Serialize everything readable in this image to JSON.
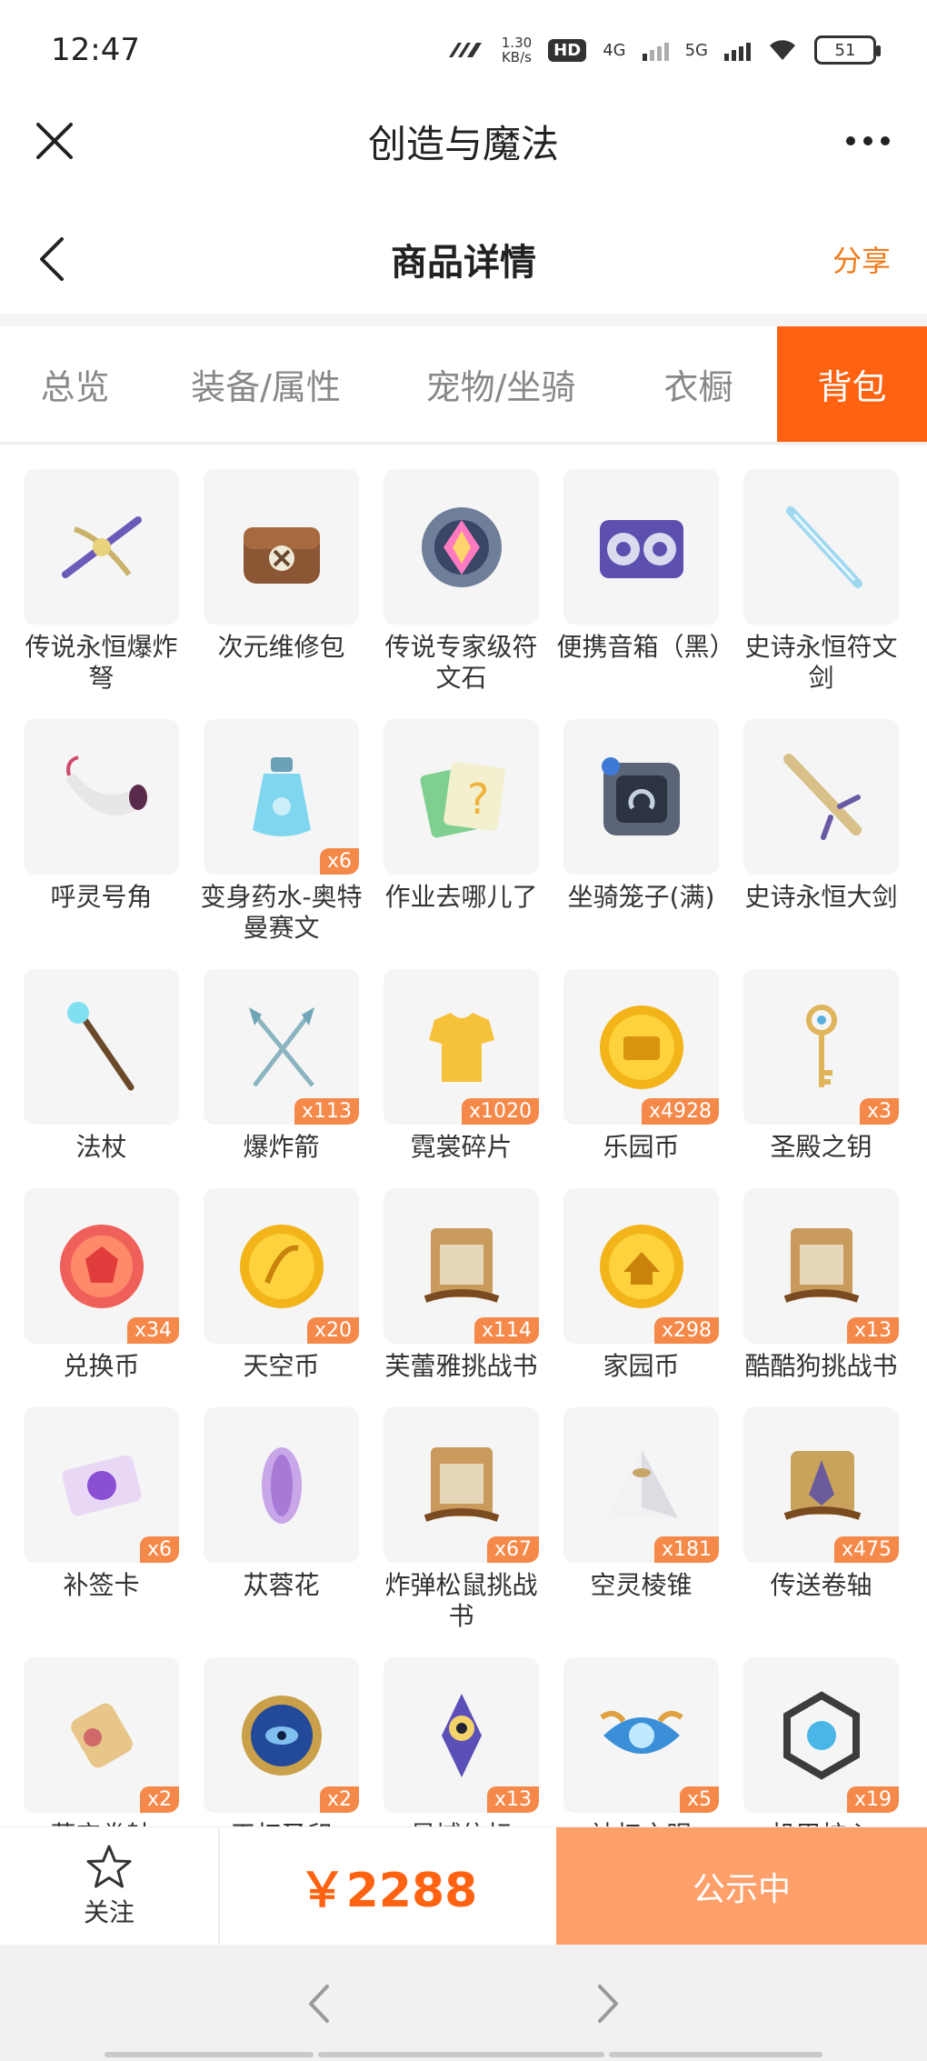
{
  "status_bar": {
    "time": "12:47",
    "net_speed_value": "1.30",
    "net_speed_unit": "KB/s",
    "hd_label": "HD",
    "sim1_label": "4G",
    "sim2_label": "5G",
    "battery": "51"
  },
  "app_bar": {
    "title": "创造与魔法"
  },
  "header": {
    "title": "商品详情",
    "share_label": "分享"
  },
  "tabs": [
    {
      "label": "总览",
      "active": false
    },
    {
      "label": "装备/属性",
      "active": false
    },
    {
      "label": "宠物/坐骑",
      "active": false
    },
    {
      "label": "衣橱",
      "active": false
    },
    {
      "label": "背包",
      "active": true
    }
  ],
  "items": [
    {
      "name": "传说永恒爆炸弩",
      "qty": "",
      "icon": "crossbow-icon"
    },
    {
      "name": "次元维修包",
      "qty": "",
      "icon": "repair-bag-icon"
    },
    {
      "name": "传说专家级符文石",
      "qty": "",
      "icon": "rune-stone-icon"
    },
    {
      "name": "便携音箱（黑）",
      "qty": "",
      "icon": "speaker-icon"
    },
    {
      "name": "史诗永恒符文剑",
      "qty": "",
      "icon": "rune-sword-icon"
    },
    {
      "name": "呼灵号角",
      "qty": "",
      "icon": "horn-icon"
    },
    {
      "name": "变身药水-奥特曼赛文",
      "qty": "x6",
      "icon": "potion-icon"
    },
    {
      "name": "作业去哪儿了",
      "qty": "",
      "icon": "homework-icon"
    },
    {
      "name": "坐骑笼子(满)",
      "qty": "",
      "icon": "mount-cage-icon"
    },
    {
      "name": "史诗永恒大剑",
      "qty": "",
      "icon": "greatsword-icon"
    },
    {
      "name": "法杖",
      "qty": "",
      "icon": "staff-icon"
    },
    {
      "name": "爆炸箭",
      "qty": "x113",
      "icon": "arrow-icon"
    },
    {
      "name": "霓裳碎片",
      "qty": "x1020",
      "icon": "shirt-fragment-icon"
    },
    {
      "name": "乐园币",
      "qty": "x4928",
      "icon": "paradise-coin-icon"
    },
    {
      "name": "圣殿之钥",
      "qty": "x3",
      "icon": "key-icon"
    },
    {
      "name": "兑换币",
      "qty": "x34",
      "icon": "exchange-coin-icon"
    },
    {
      "name": "天空币",
      "qty": "x20",
      "icon": "sky-coin-icon"
    },
    {
      "name": "芙蕾雅挑战书",
      "qty": "x114",
      "icon": "wanted-scroll-icon"
    },
    {
      "name": "家园币",
      "qty": "x298",
      "icon": "home-coin-icon"
    },
    {
      "name": "酷酷狗挑战书",
      "qty": "x13",
      "icon": "wanted-scroll-icon"
    },
    {
      "name": "补签卡",
      "qty": "x6",
      "icon": "sign-card-icon"
    },
    {
      "name": "苁蓉花",
      "qty": "",
      "icon": "flower-icon"
    },
    {
      "name": "炸弹松鼠挑战书",
      "qty": "x67",
      "icon": "wanted-scroll-icon"
    },
    {
      "name": "空灵棱锥",
      "qty": "x181",
      "icon": "pyramid-icon"
    },
    {
      "name": "传送卷轴",
      "qty": "x475",
      "icon": "teleport-scroll-icon"
    },
    {
      "name": "藏宝卷轴",
      "qty": "x2",
      "icon": "treasure-scroll-icon"
    },
    {
      "name": "天权圣印",
      "qty": "x2",
      "icon": "seal-icon"
    },
    {
      "name": "星域信标",
      "qty": "x13",
      "icon": "beacon-icon"
    },
    {
      "name": "神权之眼",
      "qty": "x5",
      "icon": "eye-icon"
    },
    {
      "name": "机甲核心",
      "qty": "x19",
      "icon": "mech-core-icon"
    }
  ],
  "action_bar": {
    "follow_label": "关注",
    "price": "￥2288",
    "status_label": "公示中"
  },
  "colors": {
    "accent": "#ff6312",
    "status_button": "#ffa06b",
    "share": "#f07a1a"
  }
}
